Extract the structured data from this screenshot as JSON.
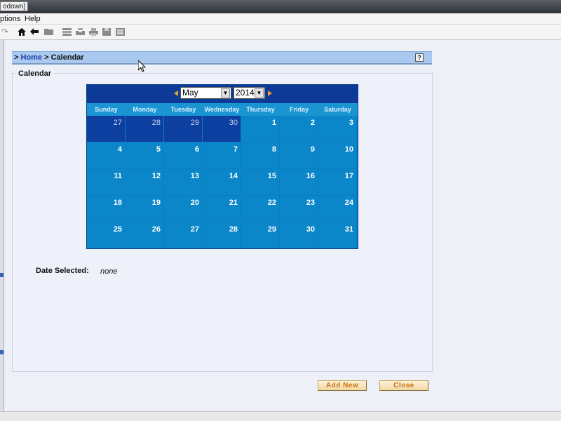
{
  "window": {
    "title": "odown]"
  },
  "menu": {
    "items": [
      "ptions",
      "Help"
    ]
  },
  "toolbar": {
    "icons": [
      "redo-icon",
      "home-icon",
      "back-icon",
      "folder-icon",
      "list-icon",
      "inbox-icon",
      "print-icon",
      "save-icon",
      "layout-icon"
    ]
  },
  "breadcrumb": {
    "prefix": ">",
    "home": "Home",
    "separator": ">",
    "current": "Calendar",
    "help": "?"
  },
  "panel": {
    "label": "Calendar"
  },
  "calendar": {
    "month": "May",
    "year": "2014",
    "weekdays": [
      "Sunday",
      "Monday",
      "Tuesday",
      "Wednesday",
      "Thursday",
      "Friday",
      "Saturday"
    ],
    "weeks": [
      [
        {
          "d": "27",
          "other": true
        },
        {
          "d": "28",
          "other": true
        },
        {
          "d": "29",
          "other": true
        },
        {
          "d": "30",
          "other": true
        },
        {
          "d": "1"
        },
        {
          "d": "2"
        },
        {
          "d": "3"
        }
      ],
      [
        {
          "d": "4"
        },
        {
          "d": "5"
        },
        {
          "d": "6"
        },
        {
          "d": "7"
        },
        {
          "d": "8"
        },
        {
          "d": "9"
        },
        {
          "d": "10"
        }
      ],
      [
        {
          "d": "11"
        },
        {
          "d": "12"
        },
        {
          "d": "13"
        },
        {
          "d": "14"
        },
        {
          "d": "15"
        },
        {
          "d": "16"
        },
        {
          "d": "17"
        }
      ],
      [
        {
          "d": "18"
        },
        {
          "d": "19"
        },
        {
          "d": "20"
        },
        {
          "d": "21"
        },
        {
          "d": "22"
        },
        {
          "d": "23"
        },
        {
          "d": "24"
        }
      ],
      [
        {
          "d": "25"
        },
        {
          "d": "26"
        },
        {
          "d": "27"
        },
        {
          "d": "28"
        },
        {
          "d": "29"
        },
        {
          "d": "30"
        },
        {
          "d": "31"
        }
      ]
    ]
  },
  "selection": {
    "label": "Date Selected:",
    "value": "none"
  },
  "actions": {
    "add_new": "Add New",
    "close": "Close"
  },
  "colors": {
    "header": "#0c3a96",
    "day": "#0a86c9",
    "other_day": "#0c3fa0",
    "accent": "#c8700f"
  }
}
